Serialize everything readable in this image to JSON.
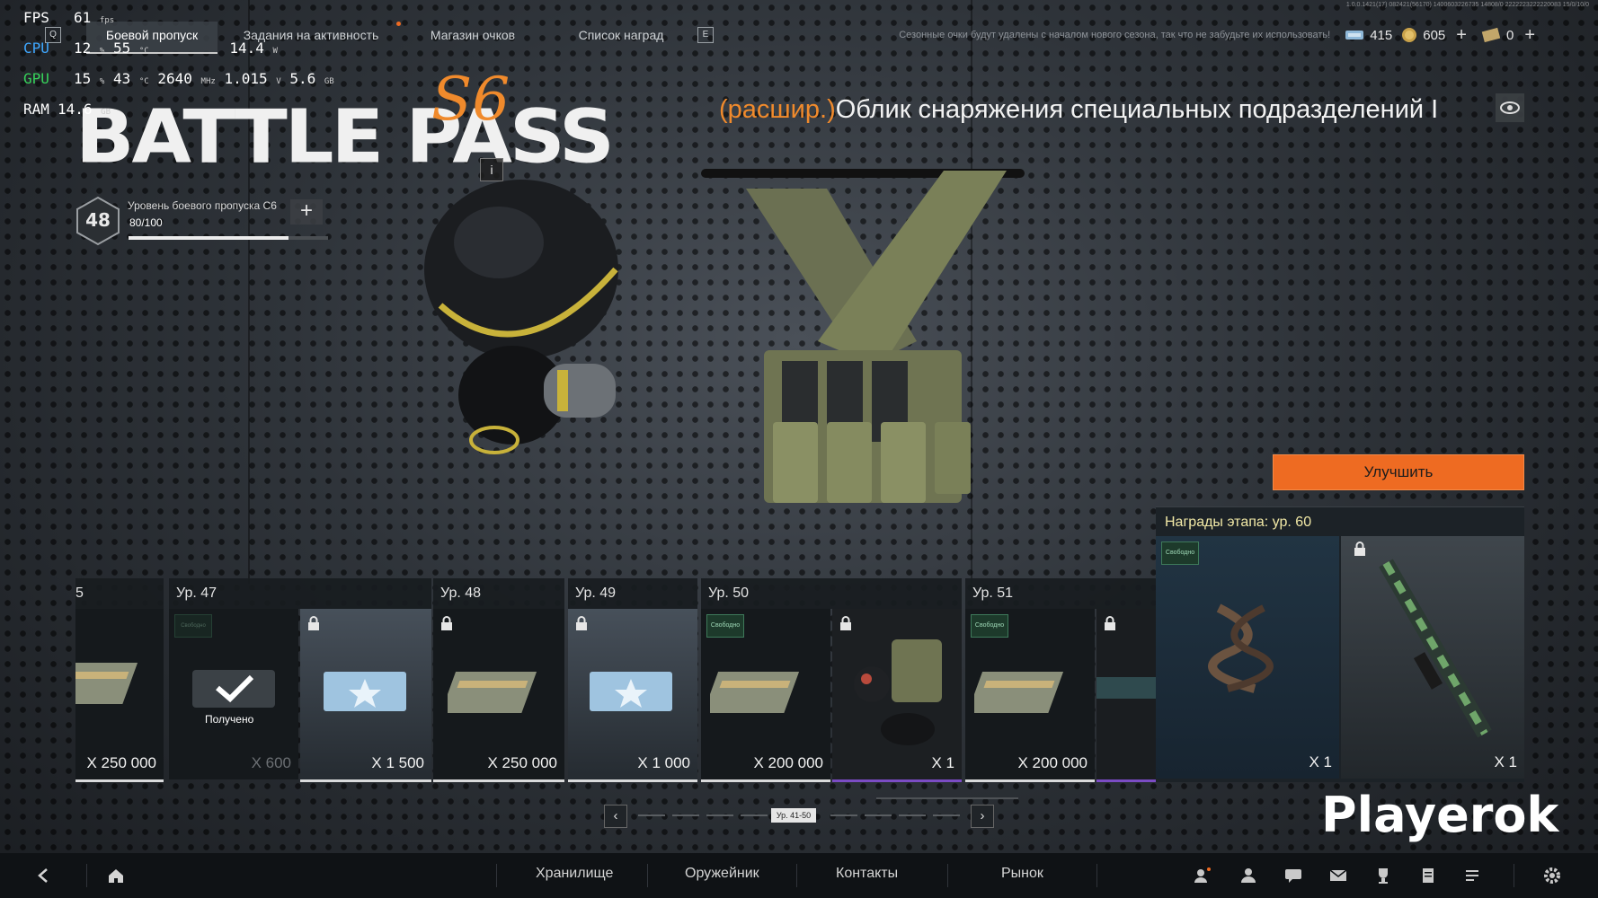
{
  "overlay": {
    "fps_label": "FPS",
    "fps_value": "61",
    "fps_unit": "fps",
    "cpu_label": "CPU",
    "cpu_load": "12",
    "cpu_load_unit": "%",
    "cpu_temp": "55",
    "cpu_temp_unit": "°C",
    "cpu_power": "14.4",
    "cpu_power_unit": "W",
    "gpu_label": "GPU",
    "gpu_load": "15",
    "gpu_load_unit": "%",
    "gpu_temp": "43",
    "gpu_temp_unit": "°C",
    "gpu_clock": "2640",
    "gpu_clock_unit": "MHz",
    "gpu_voltage": "1.015",
    "gpu_voltage_unit": "V",
    "gpu_mem": "5.6",
    "gpu_mem_unit": "GB",
    "ram_label": "RAM",
    "ram_value": "14.6",
    "ram_unit": "GB"
  },
  "nav": {
    "key_left": "Q",
    "tabs": [
      {
        "label": "Боевой пропуск",
        "active": true
      },
      {
        "label": "Задания на активность",
        "active": false
      },
      {
        "label": "Магазин очков",
        "active": false
      },
      {
        "label": "Список наград",
        "active": false
      }
    ],
    "key_right": "E"
  },
  "topright": {
    "season_note": "Сезонные очки будут удалены с началом нового сезона, так что не забудьте их использовать!",
    "currency1": "415",
    "currency2": "605",
    "currency3": "0",
    "plus": "+"
  },
  "version_text": "1.0.0.1421(17) 082421(56170) 1400603226735 14808/0 2222223222220083 15/0/10/0",
  "battlepass": {
    "logo": "BATTLE PASS",
    "season": "S6",
    "info": "i",
    "level": "48",
    "level_title": "Уровень боевого пропуска С6",
    "progress_text": "80/100",
    "progress_fraction": 0.8,
    "plus": "+"
  },
  "item": {
    "prefix": "(расшир.)",
    "name": "Облик снаряжения специальных подразделений I"
  },
  "upgrade_label": "Улучшить",
  "stage": {
    "title": "Награды этапа: ур. 60",
    "free_badge": "Свободно",
    "cards": [
      {
        "qty": "X 1"
      },
      {
        "qty": "X 1"
      }
    ]
  },
  "levels": [
    {
      "label": "5",
      "cards": [
        {
          "qty": "X 250 000"
        }
      ]
    },
    {
      "label": "Ур. 47",
      "cards": [
        {
          "qty": "X 600",
          "received": "Получено"
        },
        {
          "qty": "X 1 500"
        }
      ]
    },
    {
      "label": "Ур. 48",
      "cards": [
        {
          "qty": "X 250 000"
        }
      ]
    },
    {
      "label": "Ур. 49",
      "cards": [
        {
          "qty": "X 1 000"
        }
      ]
    },
    {
      "label": "Ур. 50",
      "cards": [
        {
          "qty": "X 200 000",
          "badge": "Свободно"
        },
        {
          "qty": "X 1"
        }
      ]
    },
    {
      "label": "Ур. 51",
      "cards": [
        {
          "qty": "X 200 000",
          "badge": "Свободно"
        },
        {
          "qty": ""
        }
      ]
    }
  ],
  "pager": {
    "prev": "‹",
    "next": "›",
    "label": "Ур. 41-50"
  },
  "bottom": {
    "items": [
      "Хранилище",
      "Оружейник",
      "Контакты",
      "Рынок"
    ]
  },
  "watermark": "Playerok",
  "colors": {
    "accent": "#ee6b22",
    "stage_title": "#f1e8a6",
    "free_badge": "#3e7a5a",
    "purple_rarity": "#7b4cc4"
  }
}
